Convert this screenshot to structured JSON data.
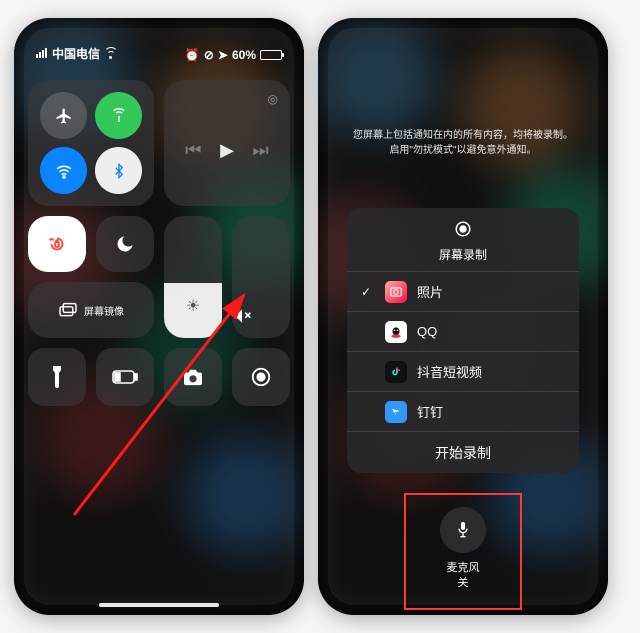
{
  "status": {
    "carrier": "中国电信",
    "battery_pct": "60%"
  },
  "left_panel": {
    "screen_mirroring_label": "屏幕镜像"
  },
  "right_panel": {
    "warning_line1": "您屏幕上包括通知在内的所有内容，均将被录制。",
    "warning_line2": "启用\"勿扰模式\"以避免意外通知。",
    "sheet_title": "屏幕录制",
    "apps": [
      {
        "name": "照片",
        "selected": true
      },
      {
        "name": "QQ",
        "selected": false
      },
      {
        "name": "抖音短视频",
        "selected": false
      },
      {
        "name": "钉钉",
        "selected": false
      }
    ],
    "start_label": "开始录制",
    "mic_label": "麦克风",
    "mic_state": "关"
  }
}
